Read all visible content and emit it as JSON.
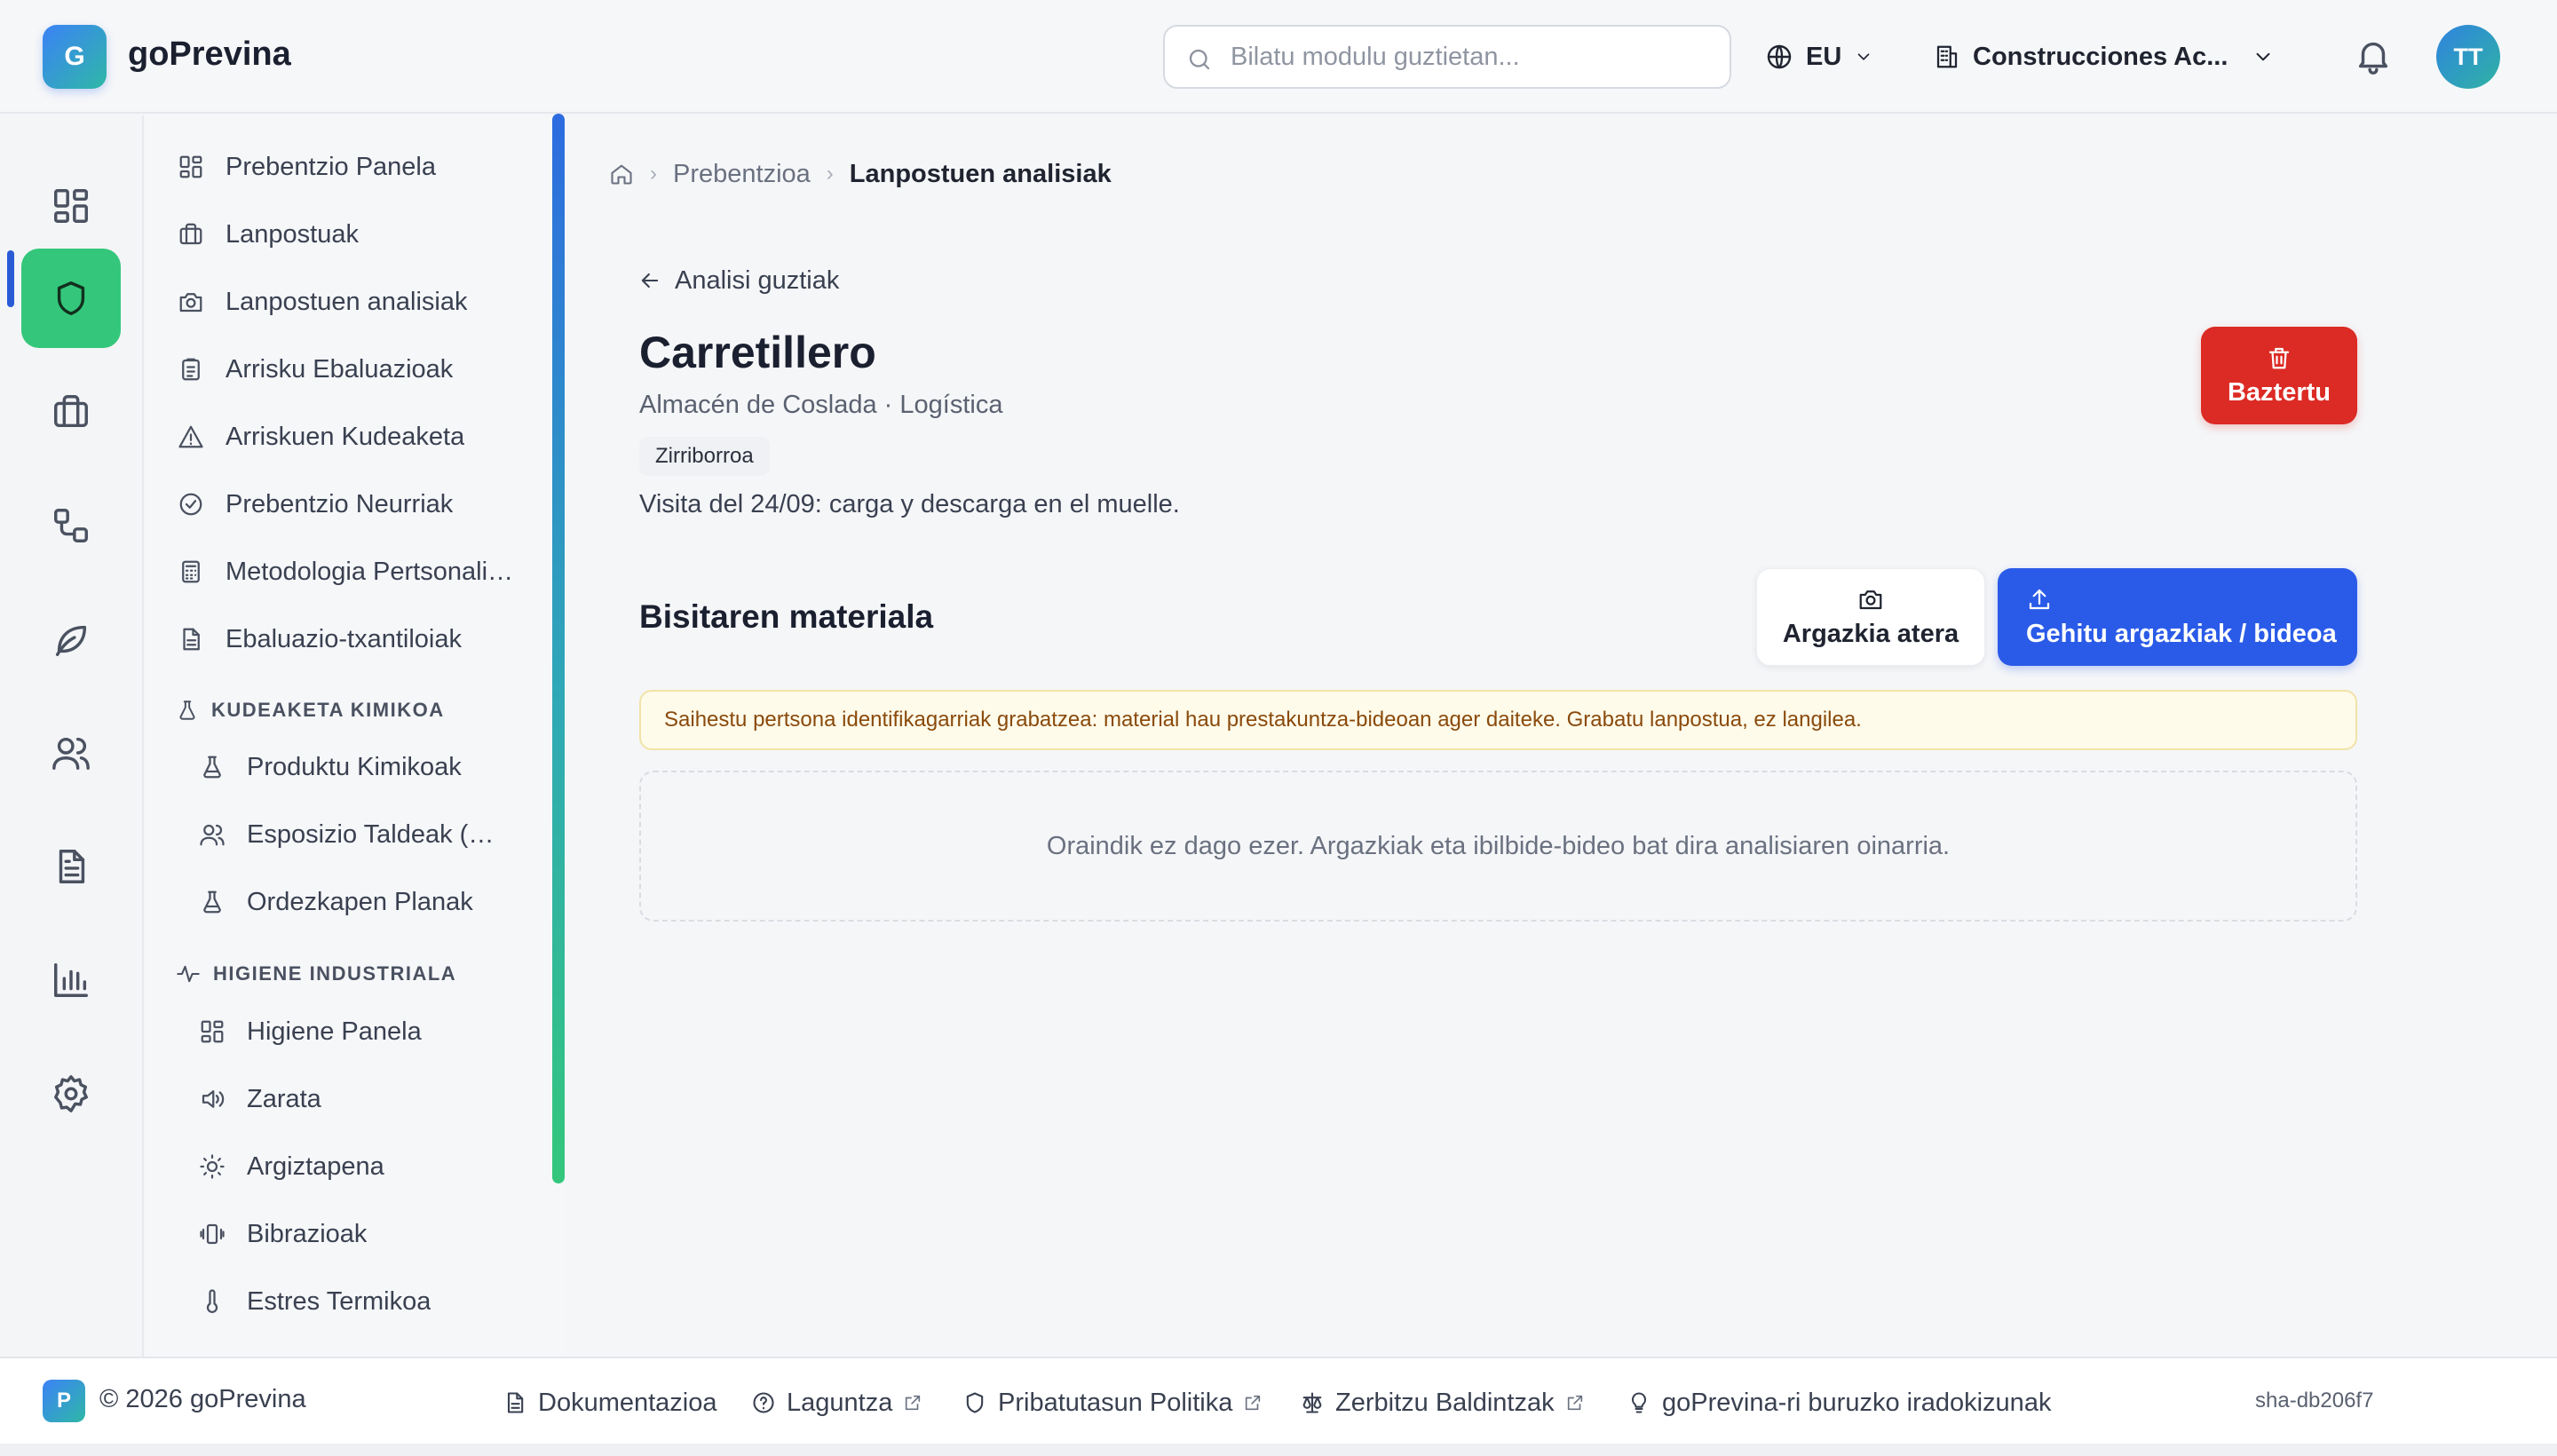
{
  "app": {
    "logo_letter": "G",
    "name": "goPrevina"
  },
  "header": {
    "search_placeholder": "Bilatu modulu guztietan...",
    "language": "EU",
    "company": "Construcciones Ac...",
    "avatar_initials": "TT"
  },
  "rail": {
    "items": [
      {
        "icon": "dashboard-icon"
      },
      {
        "icon": "shield-icon",
        "active": true
      },
      {
        "icon": "briefcase-icon"
      },
      {
        "icon": "workflow-icon"
      },
      {
        "icon": "leaf-icon"
      },
      {
        "icon": "users-icon"
      },
      {
        "icon": "document-icon"
      },
      {
        "icon": "bar-chart-icon"
      },
      {
        "icon": "gear-icon"
      }
    ]
  },
  "subnav": {
    "items": [
      {
        "label": "Prebentzio Panela",
        "icon": "dashboard-icon"
      },
      {
        "label": "Lanpostuak",
        "icon": "briefcase-icon"
      },
      {
        "label": "Lanpostuen analisiak",
        "icon": "camera-icon"
      },
      {
        "label": "Arrisku Ebaluazioak",
        "icon": "clipboard-icon"
      },
      {
        "label": "Arriskuen Kudeaketa",
        "icon": "warning-icon"
      },
      {
        "label": "Prebentzio Neurriak",
        "icon": "check-circle-icon"
      },
      {
        "label": "Metodologia Pertsonalizatuak",
        "icon": "calculator-icon"
      },
      {
        "label": "Ebaluazio-txantiloiak",
        "icon": "file-text-icon"
      }
    ],
    "section_chemical": {
      "title": "KUDEAKETA KIMIKOA",
      "items": [
        {
          "label": "Produktu Kimikoak",
          "icon": "flask-icon"
        },
        {
          "label": "Esposizio Taldeak (GHE)",
          "icon": "users-icon"
        },
        {
          "label": "Ordezkapen Planak",
          "icon": "flask-icon"
        }
      ]
    },
    "section_hygiene": {
      "title": "HIGIENE INDUSTRIALA",
      "items": [
        {
          "label": "Higiene Panela",
          "icon": "dashboard-icon"
        },
        {
          "label": "Zarata",
          "icon": "speaker-icon"
        },
        {
          "label": "Argiztapena",
          "icon": "sun-icon"
        },
        {
          "label": "Bibrazioak",
          "icon": "vibration-icon"
        },
        {
          "label": "Estres Termikoa",
          "icon": "thermometer-icon"
        }
      ]
    }
  },
  "breadcrumb": {
    "items": [
      "Prebentzioa",
      "Lanpostuen analisiak"
    ]
  },
  "page": {
    "back_label": "Analisi guztiak",
    "title": "Carretillero",
    "subtitle": "Almacén de Coslada · Logística",
    "status": "Zirriborroa",
    "description": "Visita del 24/09: carga y descarga en el muelle.",
    "delete_label": "Baztertu",
    "section_title": "Bisitaren materiala",
    "take_photo_label": "Argazkia atera",
    "upload_label": "Gehitu argazkiak / bideoa",
    "warning": "Saihestu pertsona identifikagarriak grabatzea: material hau prestakuntza-bideoan ager daiteke. Grabatu lanpostua, ez langilea.",
    "empty_text": "Oraindik ez dago ezer. Argazkiak eta ibilbide-bideo bat dira analisiaren oinarria."
  },
  "footer": {
    "logo_letter": "P",
    "copyright": "© 2026 goPrevina",
    "links": [
      {
        "label": "Dokumentazioa",
        "icon": "document-icon"
      },
      {
        "label": "Laguntza",
        "icon": "help-icon"
      },
      {
        "label": "Pribatutasun Politika",
        "icon": "shield-icon"
      },
      {
        "label": "Zerbitzu Baldintzak",
        "icon": "scale-icon"
      },
      {
        "label": "goPrevina-ri buruzko iradokizunak",
        "icon": "lightbulb-icon"
      }
    ],
    "version": "sha-db206f7"
  },
  "colors": {
    "accent_blue": "#2a5be8",
    "active_green": "#34c77b",
    "danger_red": "#dc2a24",
    "warning_bg": "#fefbea",
    "warning_text": "#8a4a0c"
  }
}
